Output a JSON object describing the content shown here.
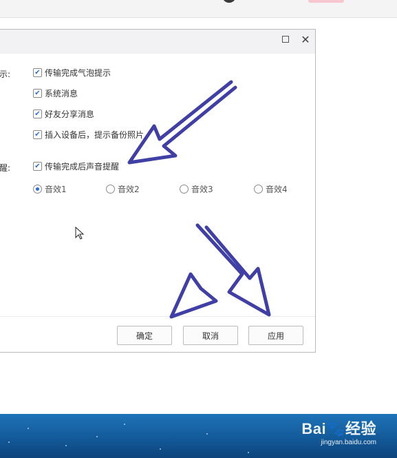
{
  "dialog": {
    "notify_section": {
      "label_fragment": "示:",
      "options": [
        {
          "label": "传输完成气泡提示",
          "checked": true
        },
        {
          "label": "系统消息",
          "checked": true
        },
        {
          "label": "好友分享消息",
          "checked": true
        },
        {
          "label": "插入设备后，提示备份照片",
          "checked": true
        }
      ]
    },
    "sound_section": {
      "label_fragment": "醒:",
      "option": {
        "label": "传输完成后声音提醒",
        "checked": true
      },
      "sounds": [
        {
          "label": "音效1",
          "selected": true
        },
        {
          "label": "音效2",
          "selected": false
        },
        {
          "label": "音效3",
          "selected": false
        },
        {
          "label": "音效4",
          "selected": false
        }
      ]
    },
    "buttons": {
      "ok": "确定",
      "cancel": "取消",
      "apply": "应用"
    },
    "window_controls": {
      "close_glyph": "✕"
    }
  },
  "watermark": {
    "logo_text": "Bai🐾经验",
    "url": "jingyan.baidu.com"
  },
  "colors": {
    "arrow": "#3f3fa6",
    "accent": "#2b6fd6",
    "desktop": "#135a99"
  }
}
